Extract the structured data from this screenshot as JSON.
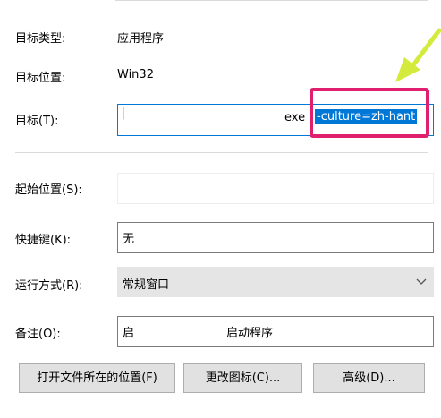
{
  "props": {
    "target_type_label": "目标类型:",
    "target_type_value": "应用程序",
    "target_location_label": "目标位置:",
    "target_location_value": "Win32",
    "target_label": "目标(T):",
    "target_value_prefix": "exe",
    "target_value_selected": "-culture=zh-hant",
    "start_in_label": "起始位置(S):",
    "start_in_value": "",
    "shortcut_key_label": "快捷键(K):",
    "shortcut_key_value": "无",
    "run_label": "运行方式(R):",
    "run_value": "常规窗口",
    "comment_label": "备注(O):",
    "comment_value_left": "启",
    "comment_value_right": "启动程序"
  },
  "buttons": {
    "open_location": "打开文件所在的位置(F)",
    "change_icon": "更改图标(C)...",
    "advanced": "高级(D)..."
  },
  "colors": {
    "highlight_box": "#e0206e",
    "arrow": "#d4ea3c",
    "selection": "#0078d7"
  }
}
